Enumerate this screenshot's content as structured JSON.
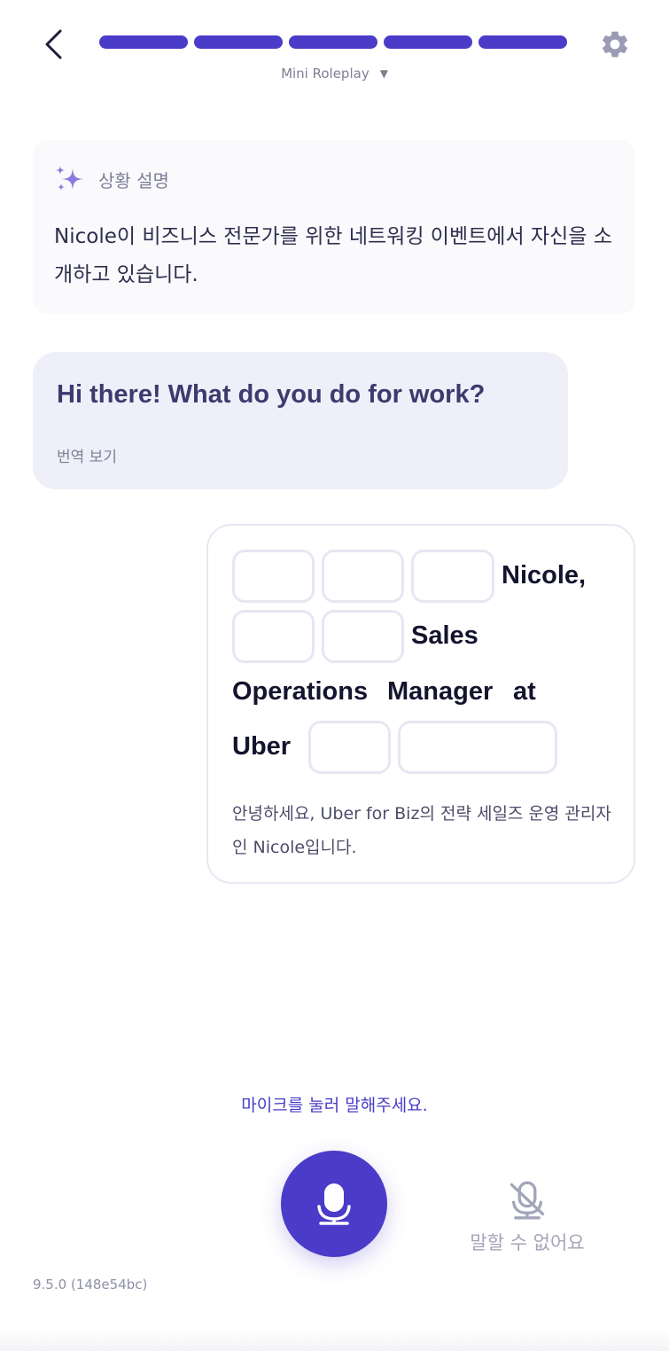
{
  "header": {
    "progress_segments": 5,
    "progress_completed": 5,
    "mode_label": "Mini Roleplay",
    "mode_caret": "▼",
    "progress_color": "#4a3bc8"
  },
  "situation": {
    "icon": "sparkle-icon",
    "title": "상황 설명",
    "text": "Nicole이 비즈니스 전문가를 위한 네트워킹 이벤트에서 자신을 소개하고 있습니다."
  },
  "ai_message": {
    "text": "Hi there! What do you do for work?",
    "translate_label": "번역 보기"
  },
  "answer": {
    "words": [
      "Nicole,",
      "Sales",
      "Operations",
      "Manager",
      "at",
      "Uber"
    ],
    "blank_count": 7,
    "translation": "안녕하세요, Uber for Biz의 전략 세일즈 운영 관리자인 Nicole입니다."
  },
  "controls": {
    "mic_hint": "마이크를 눌러 말해주세요.",
    "mic_icon": "microphone-icon",
    "cant_speak_label": "말할 수 없어요",
    "cant_speak_icon": "microphone-off-icon"
  },
  "footer": {
    "version": "9.5.0 (148e54bc)"
  }
}
